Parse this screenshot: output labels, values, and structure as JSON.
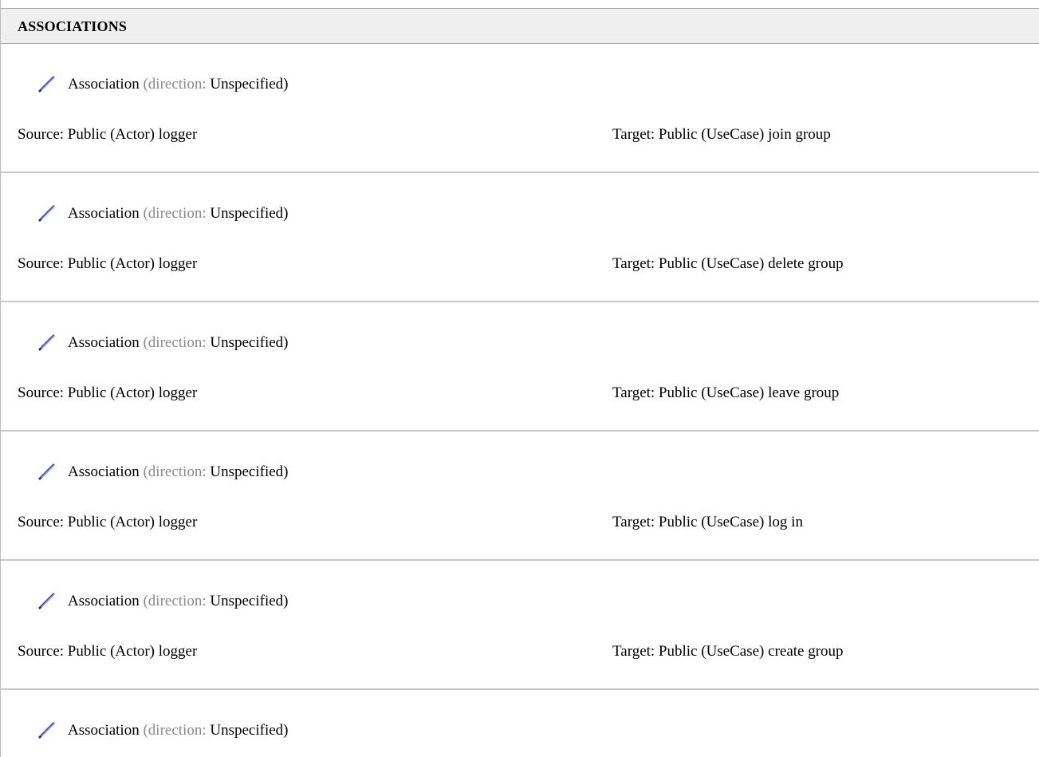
{
  "section": {
    "title": "ASSOCIATIONS"
  },
  "associations": [
    {
      "label": "Association",
      "open_paren": "(",
      "direction_label": "direction:",
      "direction_value": "Unspecified)",
      "source": "Source: Public (Actor) logger",
      "target": "Target: Public (UseCase) join group"
    },
    {
      "label": "Association",
      "open_paren": "(",
      "direction_label": "direction:",
      "direction_value": "Unspecified)",
      "source": "Source: Public (Actor) logger",
      "target": "Target: Public (UseCase) delete group"
    },
    {
      "label": "Association",
      "open_paren": "(",
      "direction_label": "direction:",
      "direction_value": "Unspecified)",
      "source": "Source: Public (Actor) logger",
      "target": "Target: Public (UseCase) leave group"
    },
    {
      "label": "Association",
      "open_paren": "(",
      "direction_label": "direction:",
      "direction_value": "Unspecified)",
      "source": "Source: Public (Actor) logger",
      "target": "Target: Public (UseCase) log in"
    },
    {
      "label": "Association",
      "open_paren": "(",
      "direction_label": "direction:",
      "direction_value": "Unspecified)",
      "source": "Source: Public (Actor) logger",
      "target": "Target: Public (UseCase) create group"
    },
    {
      "label": "Association",
      "open_paren": "(",
      "direction_label": "direction:",
      "direction_value": "Unspecified)"
    }
  ],
  "icons": {
    "association": "pencil-icon"
  },
  "colors": {
    "header_bg": "#efefef",
    "muted_text": "#8a8a8a",
    "divider": "#c8c8c8"
  }
}
